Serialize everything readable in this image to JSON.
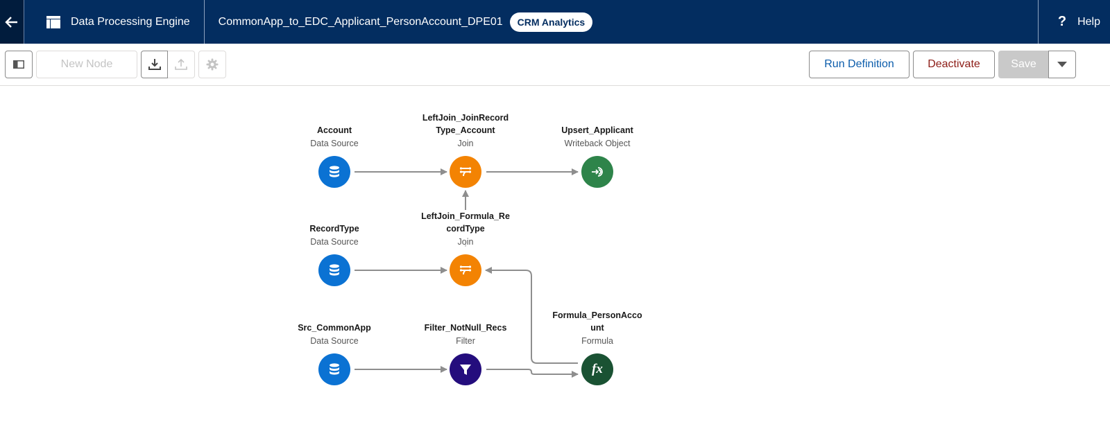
{
  "header": {
    "back_icon": "arrow-left-icon",
    "app_icon": "table-layout-icon",
    "app_name": "Data Processing Engine",
    "definition_name": "CommonApp_to_EDC_Applicant_PersonAccount_DPE01",
    "badge": "CRM Analytics",
    "help_icon": "question-mark-icon",
    "help_label": "Help"
  },
  "toolbar": {
    "panel_toggle_icon": "panel-toggle-icon",
    "new_node_label": "New Node",
    "download_icon": "download-icon",
    "upload_icon": "upload-icon",
    "settings_icon": "gear-icon",
    "run_label": "Run Definition",
    "deactivate_label": "Deactivate",
    "save_label": "Save",
    "save_menu_icon": "caret-down-icon"
  },
  "colors": {
    "header_bg": "#032d60",
    "data_source": "#0b72d3",
    "join": "#f38303",
    "writeback": "#2e844a",
    "filter": "#240d7d",
    "formula": "#1a5233",
    "edge": "#8e8e8e"
  },
  "nodes": [
    {
      "id": "account",
      "name": "Account",
      "type": "Data Source",
      "icon": "database-icon"
    },
    {
      "id": "join1",
      "name": "LeftJoin_JoinRecordType_Account",
      "type": "Join",
      "icon": "join-icon"
    },
    {
      "id": "upsert",
      "name": "Upsert_Applicant",
      "type": "Writeback Object",
      "icon": "writeback-icon"
    },
    {
      "id": "recordtype",
      "name": "RecordType",
      "type": "Data Source",
      "icon": "database-icon"
    },
    {
      "id": "join2",
      "name": "LeftJoin_Formula_RecordType",
      "type": "Join",
      "icon": "join-icon"
    },
    {
      "id": "src",
      "name": "Src_CommonApp",
      "type": "Data Source",
      "icon": "database-icon"
    },
    {
      "id": "filter",
      "name": "Filter_NotNull_Recs",
      "type": "Filter",
      "icon": "filter-icon"
    },
    {
      "id": "formula",
      "name": "Formula_PersonAccount",
      "type": "Formula",
      "icon": "fx"
    }
  ],
  "edges": [
    {
      "from": "account",
      "to": "join1"
    },
    {
      "from": "join1",
      "to": "upsert"
    },
    {
      "from": "join2",
      "to": "join1"
    },
    {
      "from": "recordtype",
      "to": "join2"
    },
    {
      "from": "formula",
      "to": "join2"
    },
    {
      "from": "src",
      "to": "filter"
    },
    {
      "from": "filter",
      "to": "formula"
    }
  ]
}
